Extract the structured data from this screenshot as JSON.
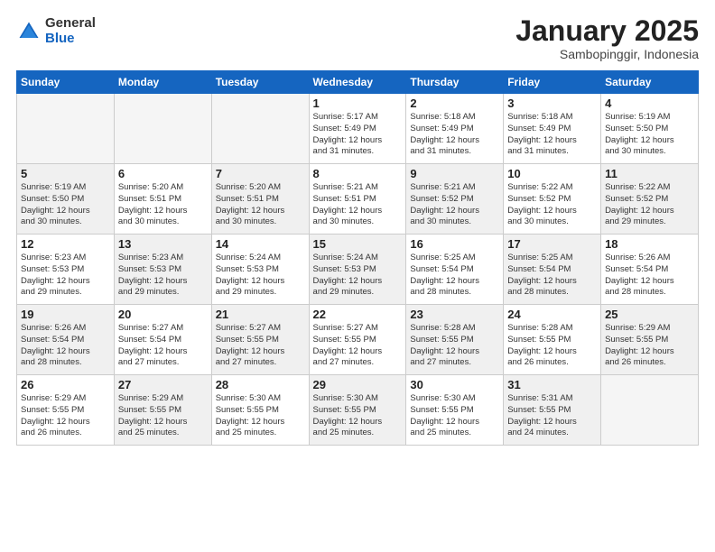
{
  "header": {
    "logo_general": "General",
    "logo_blue": "Blue",
    "title": "January 2025",
    "subtitle": "Sambopinggir, Indonesia"
  },
  "days_of_week": [
    "Sunday",
    "Monday",
    "Tuesday",
    "Wednesday",
    "Thursday",
    "Friday",
    "Saturday"
  ],
  "weeks": [
    [
      {
        "day": "",
        "info": "",
        "empty": true
      },
      {
        "day": "",
        "info": "",
        "empty": true
      },
      {
        "day": "",
        "info": "",
        "empty": true
      },
      {
        "day": "1",
        "info": "Sunrise: 5:17 AM\nSunset: 5:49 PM\nDaylight: 12 hours\nand 31 minutes."
      },
      {
        "day": "2",
        "info": "Sunrise: 5:18 AM\nSunset: 5:49 PM\nDaylight: 12 hours\nand 31 minutes."
      },
      {
        "day": "3",
        "info": "Sunrise: 5:18 AM\nSunset: 5:49 PM\nDaylight: 12 hours\nand 31 minutes."
      },
      {
        "day": "4",
        "info": "Sunrise: 5:19 AM\nSunset: 5:50 PM\nDaylight: 12 hours\nand 30 minutes."
      }
    ],
    [
      {
        "day": "5",
        "info": "Sunrise: 5:19 AM\nSunset: 5:50 PM\nDaylight: 12 hours\nand 30 minutes.",
        "shaded": true
      },
      {
        "day": "6",
        "info": "Sunrise: 5:20 AM\nSunset: 5:51 PM\nDaylight: 12 hours\nand 30 minutes."
      },
      {
        "day": "7",
        "info": "Sunrise: 5:20 AM\nSunset: 5:51 PM\nDaylight: 12 hours\nand 30 minutes.",
        "shaded": true
      },
      {
        "day": "8",
        "info": "Sunrise: 5:21 AM\nSunset: 5:51 PM\nDaylight: 12 hours\nand 30 minutes."
      },
      {
        "day": "9",
        "info": "Sunrise: 5:21 AM\nSunset: 5:52 PM\nDaylight: 12 hours\nand 30 minutes.",
        "shaded": true
      },
      {
        "day": "10",
        "info": "Sunrise: 5:22 AM\nSunset: 5:52 PM\nDaylight: 12 hours\nand 30 minutes."
      },
      {
        "day": "11",
        "info": "Sunrise: 5:22 AM\nSunset: 5:52 PM\nDaylight: 12 hours\nand 29 minutes.",
        "shaded": true
      }
    ],
    [
      {
        "day": "12",
        "info": "Sunrise: 5:23 AM\nSunset: 5:53 PM\nDaylight: 12 hours\nand 29 minutes."
      },
      {
        "day": "13",
        "info": "Sunrise: 5:23 AM\nSunset: 5:53 PM\nDaylight: 12 hours\nand 29 minutes.",
        "shaded": true
      },
      {
        "day": "14",
        "info": "Sunrise: 5:24 AM\nSunset: 5:53 PM\nDaylight: 12 hours\nand 29 minutes."
      },
      {
        "day": "15",
        "info": "Sunrise: 5:24 AM\nSunset: 5:53 PM\nDaylight: 12 hours\nand 29 minutes.",
        "shaded": true
      },
      {
        "day": "16",
        "info": "Sunrise: 5:25 AM\nSunset: 5:54 PM\nDaylight: 12 hours\nand 28 minutes."
      },
      {
        "day": "17",
        "info": "Sunrise: 5:25 AM\nSunset: 5:54 PM\nDaylight: 12 hours\nand 28 minutes.",
        "shaded": true
      },
      {
        "day": "18",
        "info": "Sunrise: 5:26 AM\nSunset: 5:54 PM\nDaylight: 12 hours\nand 28 minutes."
      }
    ],
    [
      {
        "day": "19",
        "info": "Sunrise: 5:26 AM\nSunset: 5:54 PM\nDaylight: 12 hours\nand 28 minutes.",
        "shaded": true
      },
      {
        "day": "20",
        "info": "Sunrise: 5:27 AM\nSunset: 5:54 PM\nDaylight: 12 hours\nand 27 minutes."
      },
      {
        "day": "21",
        "info": "Sunrise: 5:27 AM\nSunset: 5:55 PM\nDaylight: 12 hours\nand 27 minutes.",
        "shaded": true
      },
      {
        "day": "22",
        "info": "Sunrise: 5:27 AM\nSunset: 5:55 PM\nDaylight: 12 hours\nand 27 minutes."
      },
      {
        "day": "23",
        "info": "Sunrise: 5:28 AM\nSunset: 5:55 PM\nDaylight: 12 hours\nand 27 minutes.",
        "shaded": true
      },
      {
        "day": "24",
        "info": "Sunrise: 5:28 AM\nSunset: 5:55 PM\nDaylight: 12 hours\nand 26 minutes."
      },
      {
        "day": "25",
        "info": "Sunrise: 5:29 AM\nSunset: 5:55 PM\nDaylight: 12 hours\nand 26 minutes.",
        "shaded": true
      }
    ],
    [
      {
        "day": "26",
        "info": "Sunrise: 5:29 AM\nSunset: 5:55 PM\nDaylight: 12 hours\nand 26 minutes."
      },
      {
        "day": "27",
        "info": "Sunrise: 5:29 AM\nSunset: 5:55 PM\nDaylight: 12 hours\nand 25 minutes.",
        "shaded": true
      },
      {
        "day": "28",
        "info": "Sunrise: 5:30 AM\nSunset: 5:55 PM\nDaylight: 12 hours\nand 25 minutes."
      },
      {
        "day": "29",
        "info": "Sunrise: 5:30 AM\nSunset: 5:55 PM\nDaylight: 12 hours\nand 25 minutes.",
        "shaded": true
      },
      {
        "day": "30",
        "info": "Sunrise: 5:30 AM\nSunset: 5:55 PM\nDaylight: 12 hours\nand 25 minutes."
      },
      {
        "day": "31",
        "info": "Sunrise: 5:31 AM\nSunset: 5:55 PM\nDaylight: 12 hours\nand 24 minutes.",
        "shaded": true
      },
      {
        "day": "",
        "info": "",
        "empty": true
      }
    ]
  ]
}
